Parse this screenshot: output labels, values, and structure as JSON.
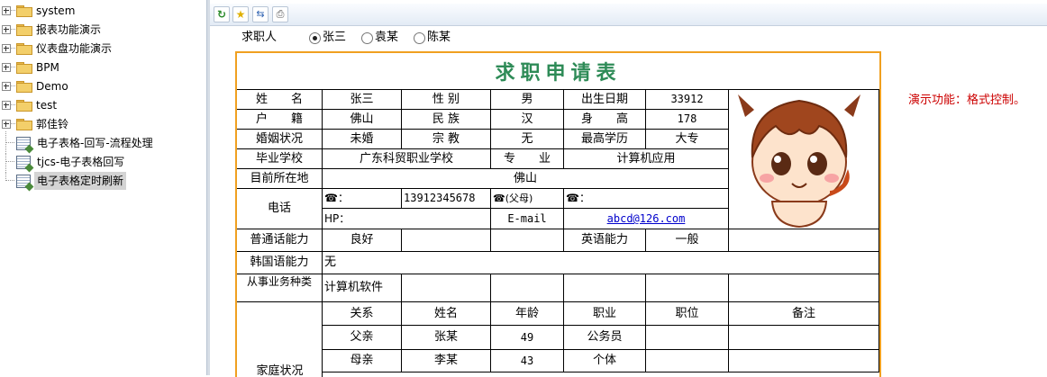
{
  "tree": {
    "folders": [
      "system",
      "报表功能演示",
      "仪表盘功能演示",
      "BPM",
      "Demo",
      "test",
      "郭佳铃"
    ],
    "leaves": [
      "电子表格-回写-流程处理",
      "tjcs-电子表格回写",
      "电子表格定时刷新"
    ],
    "selected_leaf": "电子表格定时刷新"
  },
  "toolbar": {
    "icons": [
      "refresh-icon",
      "star-icon",
      "export-icon",
      "print-icon"
    ]
  },
  "applicant": {
    "label": "求职人",
    "options": [
      "张三",
      "袁某",
      "陈某"
    ],
    "selected": "张三"
  },
  "note": "演示功能：格式控制。",
  "form": {
    "title": "求职申请表",
    "row1": {
      "name_label": "姓　　名",
      "name": "张三",
      "gender_label": "性 别",
      "gender": "男",
      "birth_label": "出生日期",
      "birth": "33912"
    },
    "row2": {
      "hukou_label": "户　　籍",
      "hukou": "佛山",
      "ethnic_label": "民 族",
      "ethnic": "汉",
      "height_label": "身　　高",
      "height": "178"
    },
    "row3": {
      "marital_label": "婚姻状况",
      "marital": "未婚",
      "religion_label": "宗 教",
      "religion": "无",
      "edu_label": "最高学历",
      "edu": "大专"
    },
    "row4": {
      "school_label": "毕业学校",
      "school": "广东科贸职业学校",
      "major_label": "专　　业",
      "major": "计算机应用"
    },
    "row5": {
      "location_label": "目前所在地",
      "location": "佛山"
    },
    "phone": {
      "label": "电话",
      "tel_prefix": "☎：",
      "tel": "13912345678",
      "father_prefix": "☎(父母)",
      "other_prefix": "☎：",
      "hp_label": "HP：",
      "email_label": "E-mail",
      "email": "abcd@126.com"
    },
    "row_mandarin": {
      "label": "普通话能力",
      "value": "良好",
      "english_label": "英语能力",
      "english": "一般"
    },
    "row_korean": {
      "label": "韩国语能力",
      "value": "无"
    },
    "row_job": {
      "label": "从事业务种类",
      "value": "计算机软件"
    },
    "family": {
      "label": "家庭状况",
      "headers": [
        "关系",
        "姓名",
        "年龄",
        "职业",
        "职位",
        "备注"
      ],
      "rows": [
        [
          "父亲",
          "张某",
          "49",
          "公务员",
          "",
          ""
        ],
        [
          "母亲",
          "李某",
          "43",
          "个体",
          "",
          ""
        ]
      ]
    }
  }
}
